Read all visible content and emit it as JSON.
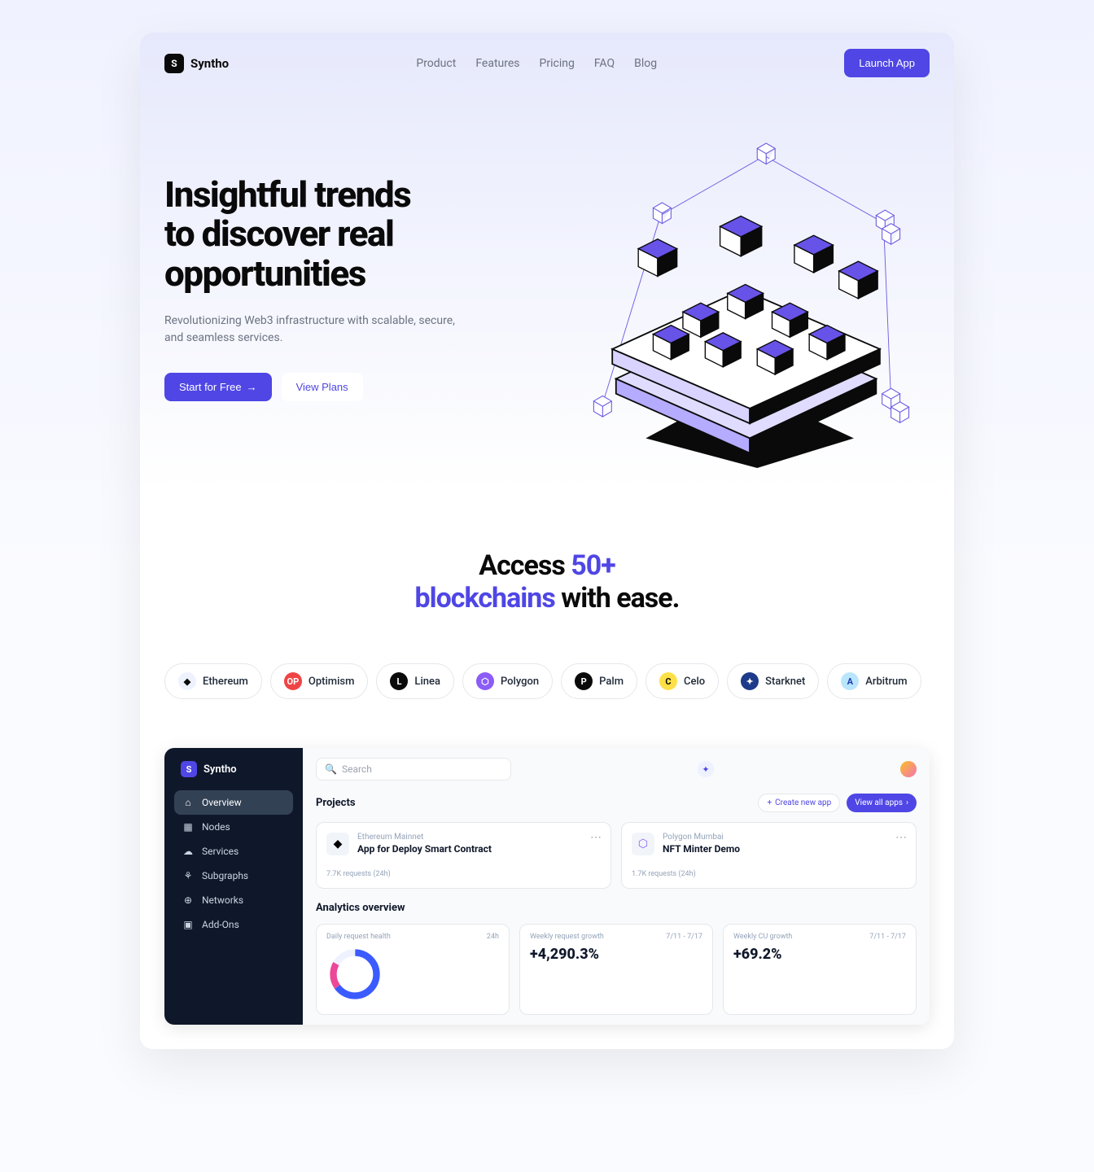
{
  "brand": "Syntho",
  "nav": {
    "items": [
      "Product",
      "Features",
      "Pricing",
      "FAQ",
      "Blog"
    ],
    "launch": "Launch App"
  },
  "hero": {
    "title_line1": "Insightful trends",
    "title_line2": "to discover real",
    "title_line3": "opportunities",
    "subtitle": "Revolutionizing Web3 infrastructure with scalable, secure, and seamless services.",
    "cta_primary": "Start for Free",
    "cta_secondary": "View Plans"
  },
  "access": {
    "pre": "Access ",
    "accent1": "50+",
    "accent2": "blockchains",
    "post": " with ease."
  },
  "chains": [
    {
      "name": "Ethereum",
      "icon": "◆",
      "bg": "#eef2ff",
      "fg": "#0a0a0a"
    },
    {
      "name": "Optimism",
      "icon": "OP",
      "bg": "#ef4444",
      "fg": "#fff"
    },
    {
      "name": "Linea",
      "icon": "L",
      "bg": "#0a0a0a",
      "fg": "#fff"
    },
    {
      "name": "Polygon",
      "icon": "⬡",
      "bg": "#8b5cf6",
      "fg": "#fff"
    },
    {
      "name": "Palm",
      "icon": "P",
      "bg": "#0a0a0a",
      "fg": "#fff"
    },
    {
      "name": "Celo",
      "icon": "C",
      "bg": "#fde047",
      "fg": "#0a0a0a"
    },
    {
      "name": "Starknet",
      "icon": "✦",
      "bg": "#1e3a8a",
      "fg": "#fff"
    },
    {
      "name": "Arbitrum",
      "icon": "A",
      "bg": "#bae6fd",
      "fg": "#1e40af"
    }
  ],
  "dashboard": {
    "brand": "Syntho",
    "search_placeholder": "Search",
    "sidebar": [
      "Overview",
      "Nodes",
      "Services",
      "Subgraphs",
      "Networks",
      "Add-Ons"
    ],
    "projects": {
      "title": "Projects",
      "create": "Create new app",
      "view_all": "View all apps",
      "cards": [
        {
          "network": "Ethereum Mainnet",
          "name": "App for Deploy Smart Contract",
          "stats": "7.7K requests (24h)",
          "icon": "◆"
        },
        {
          "network": "Polygon  Mumbai",
          "name": "NFT Minter Demo",
          "stats": "1.7K requests (24h)",
          "icon": "⬡"
        }
      ]
    },
    "analytics": {
      "title": "Analytics overview",
      "cards": [
        {
          "label": "Daily request health",
          "period": "24h",
          "value": ""
        },
        {
          "label": "Weekly request growth",
          "period": "7/11 - 7/17",
          "value": "+4,290.3%"
        },
        {
          "label": "Weekly CU growth",
          "period": "7/11 - 7/17",
          "value": "+69.2%"
        }
      ]
    }
  }
}
